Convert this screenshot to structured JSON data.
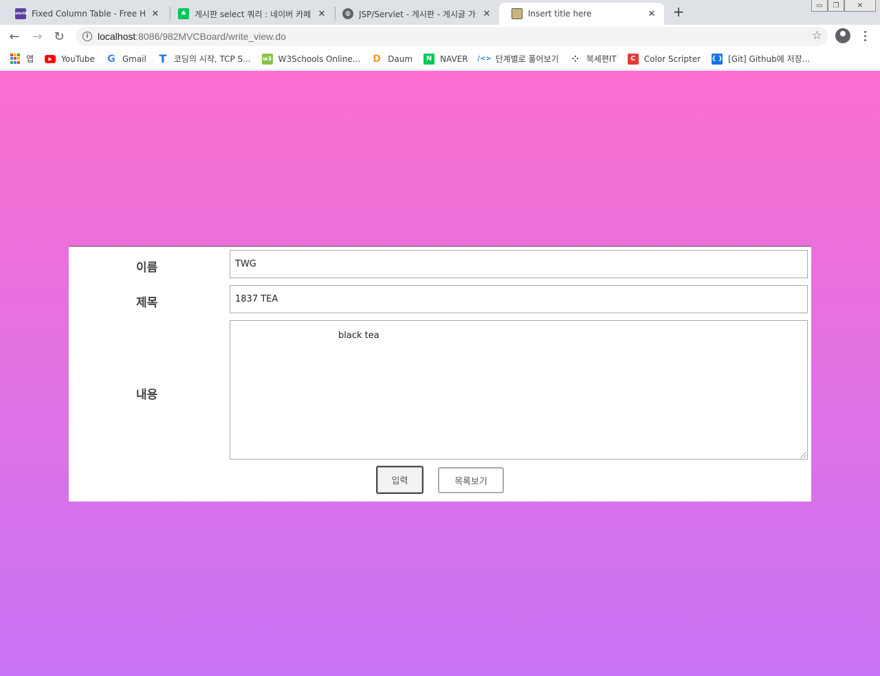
{
  "browser": {
    "tabs": [
      {
        "title": "Fixed Column Table - Free HTM",
        "favicon_color": "#5b3fa0",
        "favicon_text": "colorlib",
        "active": false
      },
      {
        "title": "게시판 select 쿼리 : 네이버 카페",
        "favicon_color": "#03c75a",
        "favicon_text": "♣",
        "active": false
      },
      {
        "title": "JSP/Servlet - 게시판 - 게시글 가",
        "favicon_color": "#5f6368",
        "favicon_text": "🌐",
        "active": false
      },
      {
        "title": "Insert title here",
        "favicon_color": "#8a7a3a",
        "favicon_text": "🖼",
        "active": true
      }
    ],
    "close_glyph": "✕",
    "new_tab_glyph": "+",
    "url_host": "localhost",
    "url_path": ":8086/982MVCBoard/write_view.do",
    "bookmarks": [
      {
        "label": "앱",
        "icon": "apps-grid-icon",
        "color": "#ea4335"
      },
      {
        "label": "YouTube",
        "icon": "youtube-icon",
        "color": "#ff0000"
      },
      {
        "label": "Gmail",
        "icon": "google-g-icon",
        "color": "#4285f4"
      },
      {
        "label": "코딩의 시작, TCP S...",
        "icon": "tcp-school-icon",
        "color": "#1a73e8"
      },
      {
        "label": "W3Schools Online...",
        "icon": "w3schools-icon",
        "color": "#8bc34a"
      },
      {
        "label": "Daum",
        "icon": "daum-icon",
        "color": "#f59a28"
      },
      {
        "label": "NAVER",
        "icon": "naver-icon",
        "color": "#03c75a"
      },
      {
        "label": "단계별로 풀어보기",
        "icon": "code-icon",
        "color": "#1e88e5"
      },
      {
        "label": "북세편IT",
        "icon": "dots-icon",
        "color": "#222222"
      },
      {
        "label": "Color Scripter",
        "icon": "color-scripter-icon",
        "color": "#e53935"
      },
      {
        "label": "[Git] Github에 저장...",
        "icon": "braces-icon",
        "color": "#1a73e8"
      }
    ]
  },
  "form": {
    "name_label": "이름",
    "name_value": "TWG",
    "title_label": "제목",
    "title_value": "1837 TEA",
    "content_label": "내용",
    "content_value": "black tea",
    "submit_label": "입력",
    "list_label": "목록보기"
  },
  "colors": {
    "gradient_top": "#fb6fd0",
    "gradient_bottom": "#c873f5"
  }
}
